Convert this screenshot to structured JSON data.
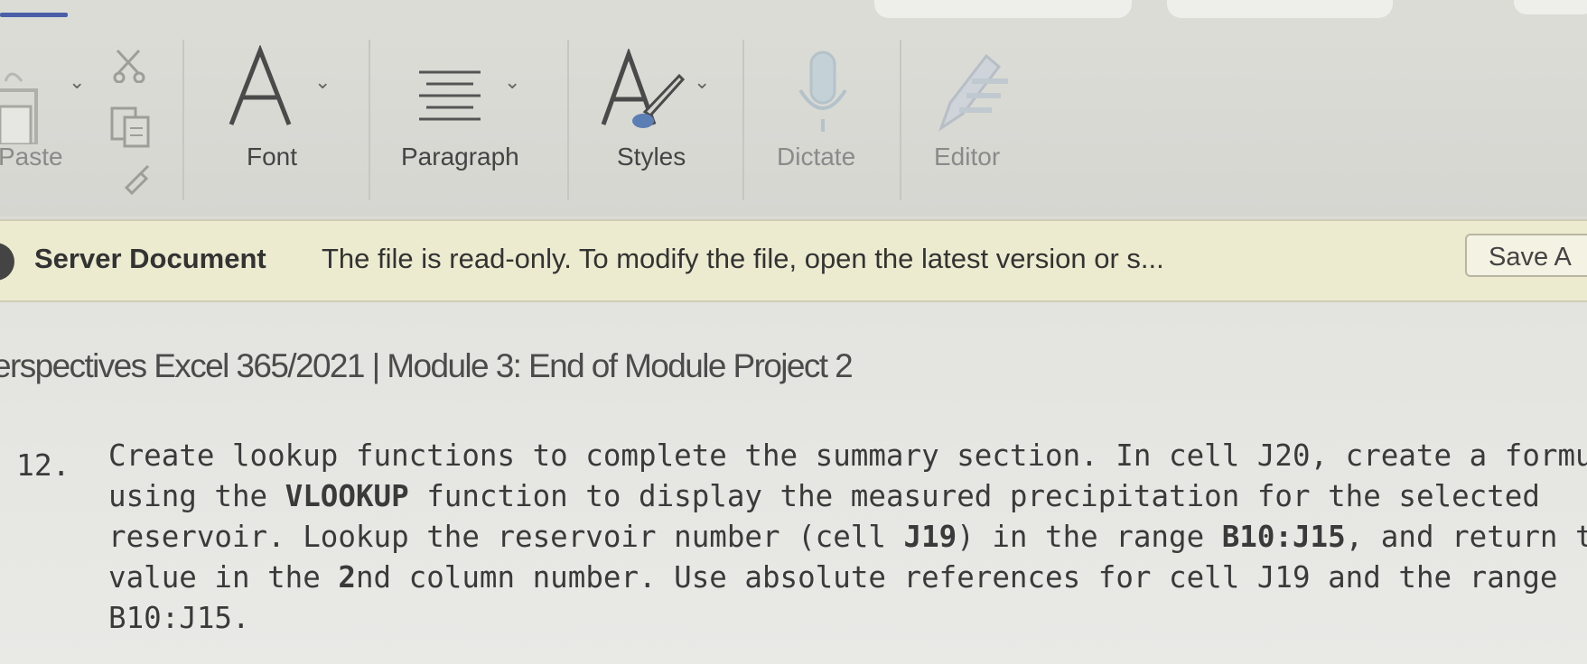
{
  "ribbon": {
    "groups": [
      {
        "label": "Paste",
        "icon": "paste-icon"
      },
      {
        "label": "Font",
        "icon": "font-icon"
      },
      {
        "label": "Paragraph",
        "icon": "paragraph-icon"
      },
      {
        "label": "Styles",
        "icon": "styles-icon"
      },
      {
        "label": "Dictate",
        "icon": "microphone-icon"
      },
      {
        "label": "Editor",
        "icon": "editor-pen-icon"
      }
    ]
  },
  "infobar": {
    "title": "Server Document",
    "message": "The file is read-only. To modify the file, open the latest version or s...",
    "save_as_label": "Save A"
  },
  "document": {
    "title": "erspectives Excel 365/2021 | Module 3: End of Module Project 2",
    "step_number": "12.",
    "lines": [
      [
        {
          "t": "Create lookup functions to complete the summary section. In cell J20, create a formula"
        }
      ],
      [
        {
          "t": "using the "
        },
        {
          "t": "VLOOKUP",
          "b": true
        },
        {
          "t": " function to display the measured precipitation for the selected"
        }
      ],
      [
        {
          "t": "reservoir. Lookup the reservoir number (cell "
        },
        {
          "t": "J19",
          "b": true
        },
        {
          "t": ") in the range "
        },
        {
          "t": "B10:J15",
          "b": true
        },
        {
          "t": ", and return the"
        }
      ],
      [
        {
          "t": "value in the "
        },
        {
          "t": "2",
          "b": true
        },
        {
          "t": "nd column number. Use absolute references for cell J19 and the range"
        }
      ],
      [
        {
          "t": "B10:J15."
        }
      ]
    ]
  },
  "colors": {
    "ribbon_bg": "#dcdcd7",
    "infobar_bg": "#eceacf",
    "text": "#3a3a3a",
    "accent": "#4a5fa8",
    "dictate_icon": "#b9c8cf"
  }
}
